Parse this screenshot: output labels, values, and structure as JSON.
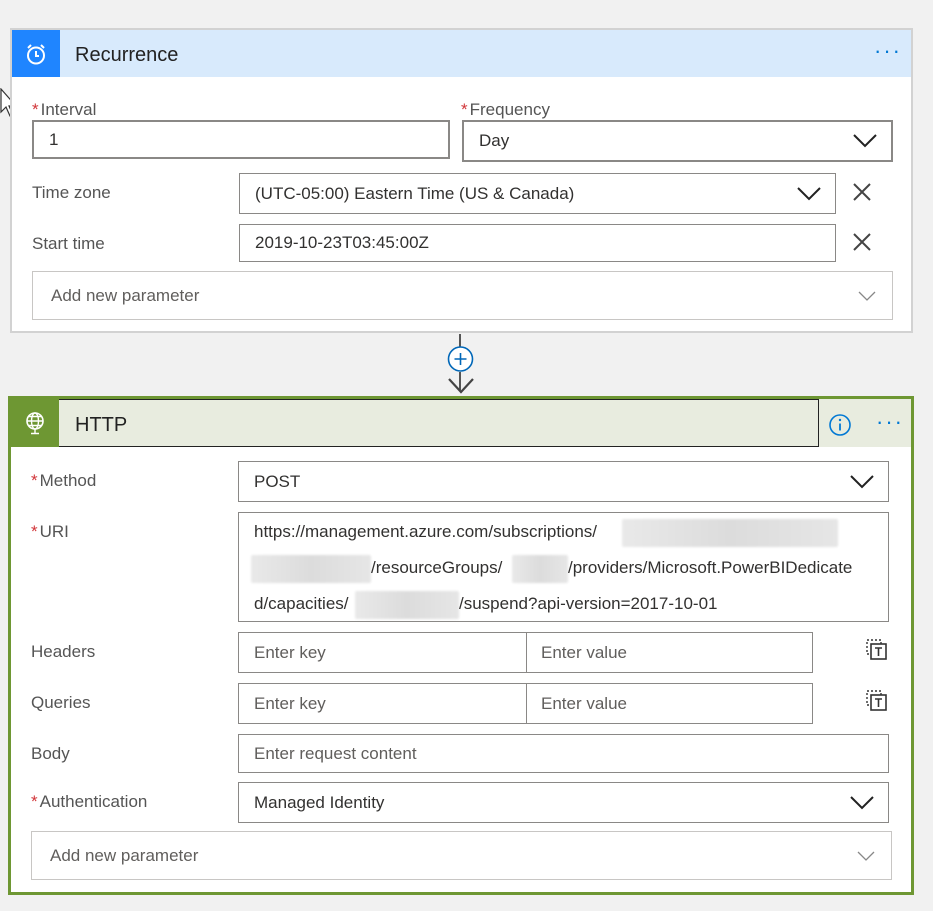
{
  "recurrence": {
    "title": "Recurrence",
    "more_label": "···",
    "interval": {
      "label": "Interval",
      "value": "1"
    },
    "frequency": {
      "label": "Frequency",
      "value": "Day"
    },
    "timezone": {
      "label": "Time zone",
      "value": "(UTC-05:00) Eastern Time (US & Canada)"
    },
    "start_time": {
      "label": "Start time",
      "value": "2019-10-23T03:45:00Z"
    },
    "add_param_placeholder": "Add new parameter"
  },
  "connector": {
    "add_icon": "plus-circle-icon",
    "arrow_icon": "arrow-down-icon"
  },
  "http": {
    "title": "HTTP",
    "more_label": "···",
    "method": {
      "label": "Method",
      "value": "POST"
    },
    "uri": {
      "label": "URI",
      "line1_prefix": "https://management.azure.com/subscriptions/",
      "line2_mid": "/resourceGroups/",
      "line2_suffix": "/providers/Microsoft.PowerBIDedicate",
      "line3_prefix": "d/capacities/",
      "line3_suffix": "/suspend?api-version=2017-10-01"
    },
    "headers": {
      "label": "Headers",
      "key_placeholder": "Enter key",
      "value_placeholder": "Enter value"
    },
    "queries": {
      "label": "Queries",
      "key_placeholder": "Enter key",
      "value_placeholder": "Enter value"
    },
    "body": {
      "label": "Body",
      "placeholder": "Enter request content"
    },
    "authentication": {
      "label": "Authentication",
      "value": "Managed Identity"
    },
    "add_param_placeholder": "Add new parameter"
  },
  "colors": {
    "recurrence_accent": "#1f85ff",
    "recurrence_header": "#d8eafc",
    "http_accent": "#6e9733",
    "http_header": "#e8ecdf",
    "required_star": "#d13438",
    "link_blue": "#0078d4"
  }
}
